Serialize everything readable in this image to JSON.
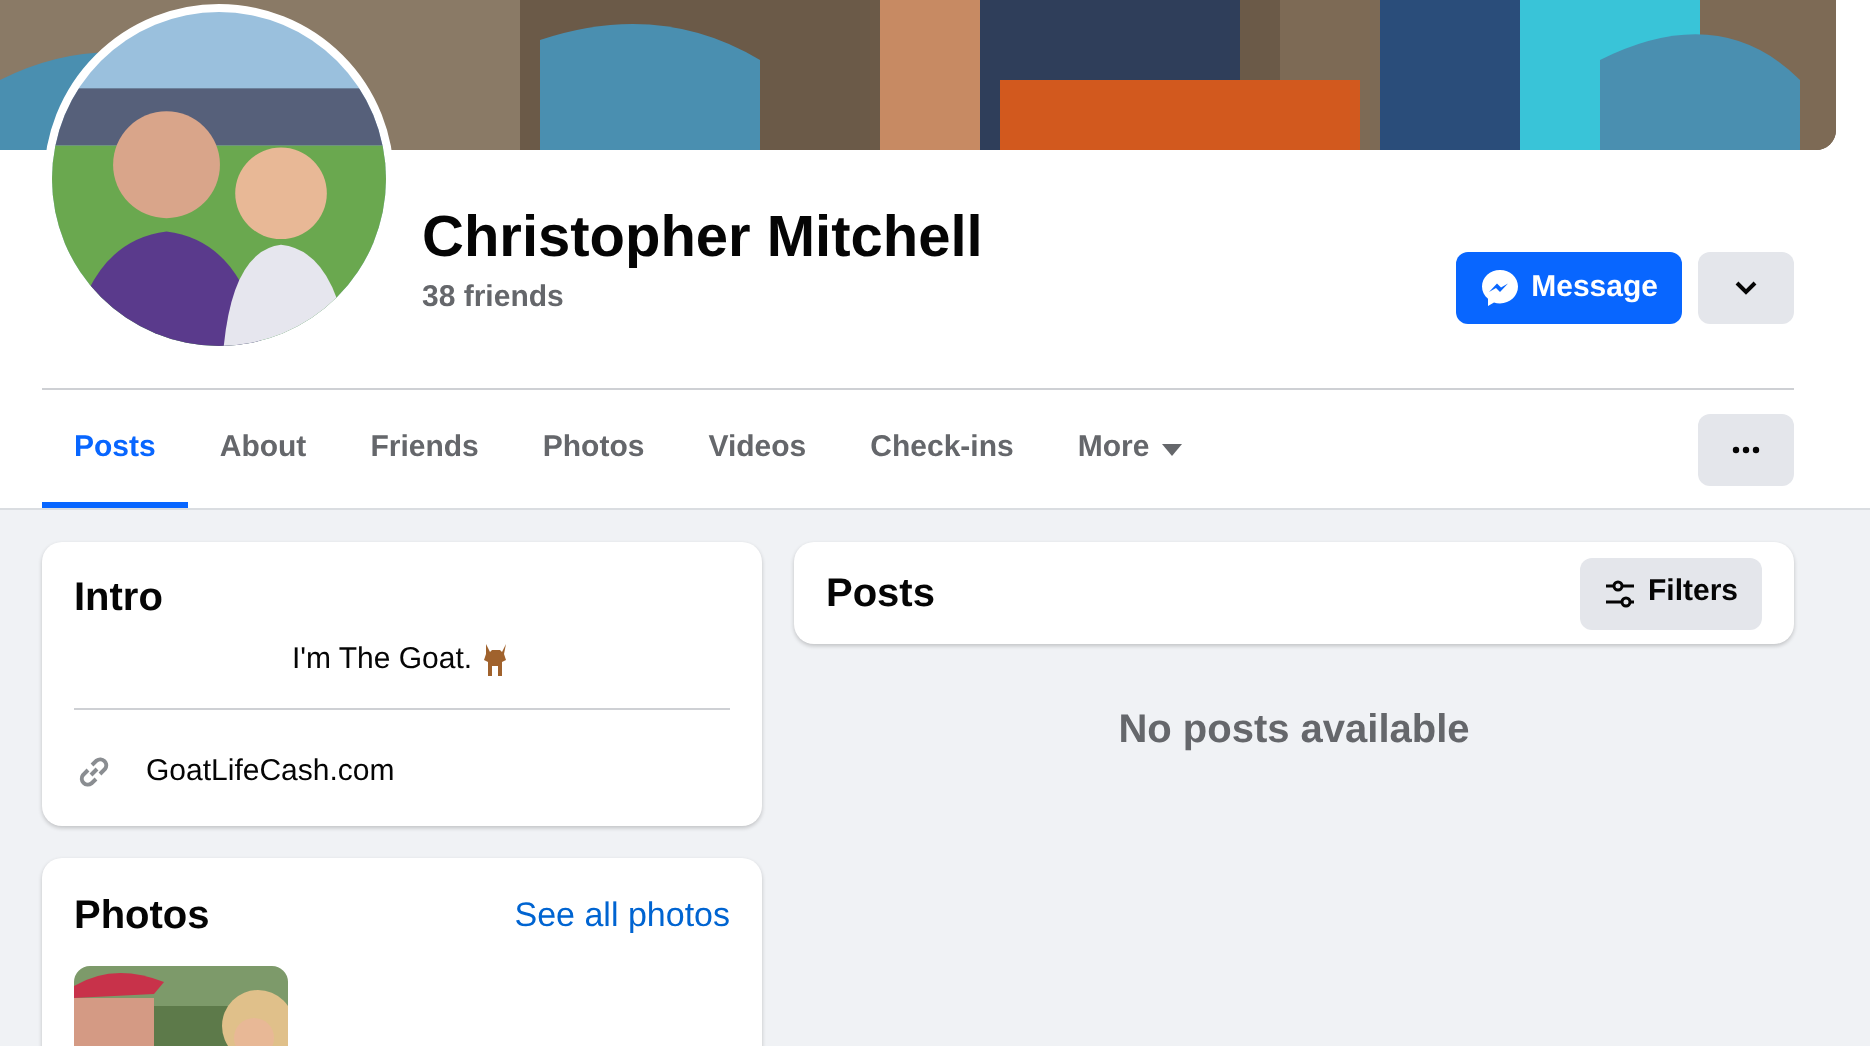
{
  "profile": {
    "name": "Christopher Mitchell",
    "friends": "38 friends"
  },
  "actions": {
    "message": "Message"
  },
  "tabs": [
    {
      "label": "Posts",
      "selected": true
    },
    {
      "label": "About",
      "selected": false
    },
    {
      "label": "Friends",
      "selected": false
    },
    {
      "label": "Photos",
      "selected": false
    },
    {
      "label": "Videos",
      "selected": false
    },
    {
      "label": "Check-ins",
      "selected": false
    },
    {
      "label": "More",
      "selected": false,
      "kind": "dropdown"
    }
  ],
  "intro": {
    "title": "Intro",
    "bio": "I'm The Goat.",
    "website": "GoatLifeCash.com"
  },
  "photos": {
    "title": "Photos",
    "link": "See all photos"
  },
  "posts": {
    "title": "Posts",
    "filters": "Filters",
    "empty": "No posts available"
  }
}
